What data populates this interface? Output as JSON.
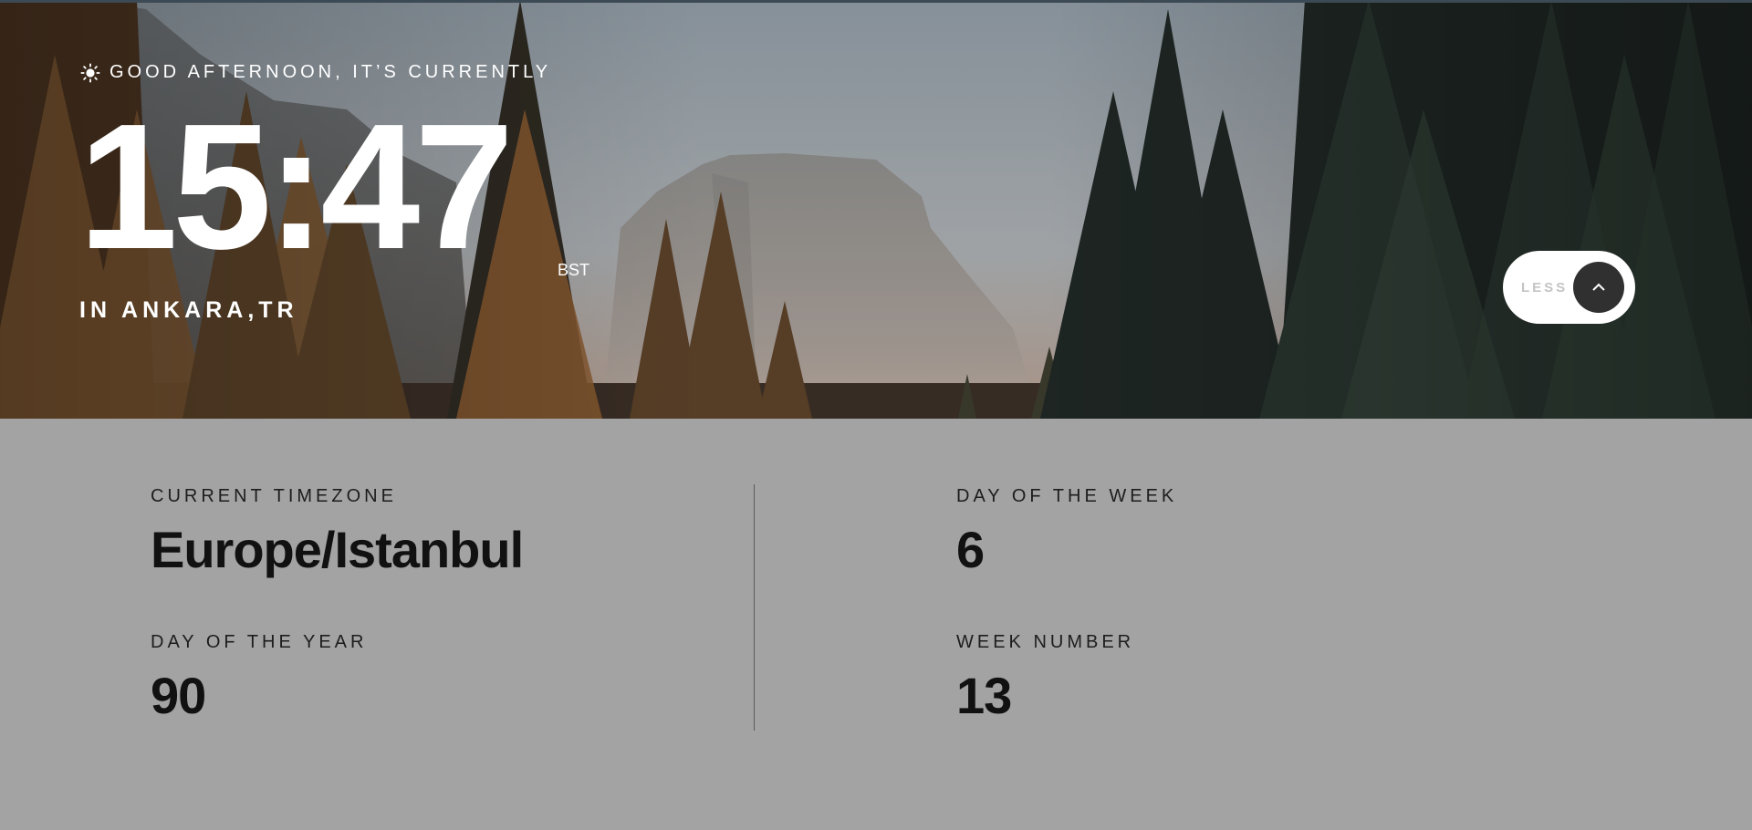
{
  "greeting": {
    "text": "GOOD AFTERNOON, IT’S CURRENTLY",
    "icon": "sun-icon"
  },
  "clock": {
    "time": "15:47",
    "abbreviation": "BST"
  },
  "location": "IN ANKARA,TR",
  "toggle": {
    "label": "LESS",
    "icon": "chevron-up-icon"
  },
  "details": {
    "timezone": {
      "label": "CURRENT TIMEZONE",
      "value": "Europe/Istanbul"
    },
    "day_of_year": {
      "label": "DAY OF THE YEAR",
      "value": "90"
    },
    "day_of_week": {
      "label": "DAY OF THE WEEK",
      "value": "6"
    },
    "week_number": {
      "label": "WEEK NUMBER",
      "value": "13"
    }
  },
  "colors": {
    "panel_bg": "#a3a3a3",
    "toggle_knob": "#303030",
    "text_dark": "#111111"
  }
}
